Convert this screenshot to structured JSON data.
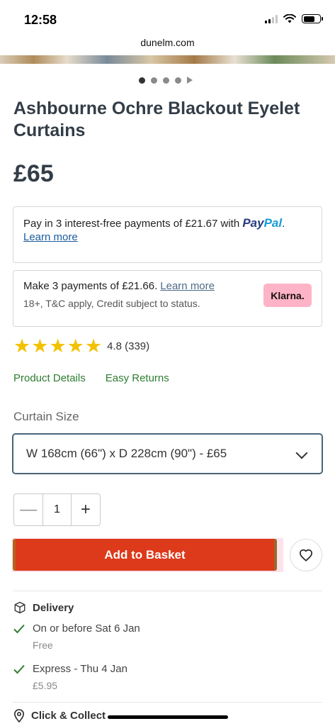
{
  "status": {
    "time": "12:58"
  },
  "browser": {
    "url": "dunelm.com"
  },
  "product": {
    "title": "Ashbourne Ochre Blackout Eyelet Curtains",
    "price": "£65",
    "rating": "4.8",
    "review_count": "(339)"
  },
  "paypal": {
    "text": "Pay in 3 interest-free payments of £21.67 with",
    "logo_pay": "Pay",
    "logo_pal": "Pal",
    "suffix": ".",
    "link": "Learn more"
  },
  "klarna": {
    "text": "Make 3 payments of £21.66.",
    "link": "Learn more",
    "note": "18+, T&C apply, Credit subject to status.",
    "badge": "Klarna."
  },
  "links": {
    "product_details": "Product Details",
    "easy_returns": "Easy Returns"
  },
  "size": {
    "label": "Curtain Size",
    "selected": "W 168cm (66\") x D 228cm (90\") - £65"
  },
  "quantity": {
    "value": "1",
    "minus": "—",
    "plus": "+"
  },
  "actions": {
    "add_to_basket": "Add to Basket"
  },
  "delivery": {
    "heading": "Delivery",
    "options": [
      {
        "title": "On or before Sat 6 Jan",
        "price": "Free"
      },
      {
        "title": "Express - Thu 4 Jan",
        "price": "£5.95"
      }
    ]
  },
  "click_collect": {
    "heading": "Click & Collect"
  },
  "colors": {
    "accent": "#dd3a1b",
    "link_green": "#2e7d32",
    "star": "#f2c200",
    "klarna_pink": "#ffb3c7"
  }
}
